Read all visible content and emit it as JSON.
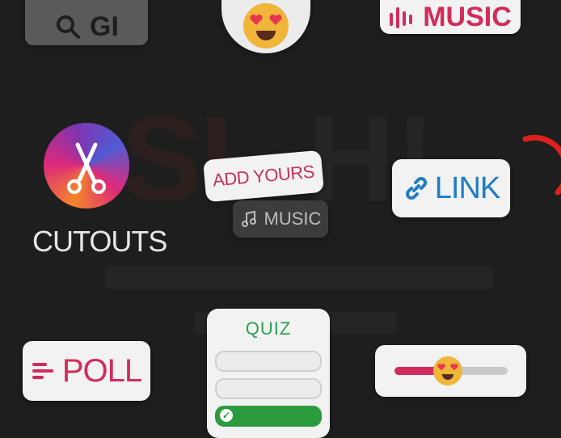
{
  "stickers": {
    "gif_search": {
      "label": "GI",
      "icon": "search-icon"
    },
    "emoji_reaction": {
      "icon": "heart-eyes-emoji-icon"
    },
    "music_top": {
      "label": "MUSIC",
      "icon": "music-bars-icon",
      "accent": "#d32b5b"
    },
    "cutouts": {
      "label": "CUTOUTS",
      "icon": "scissors-icon"
    },
    "add_yours": {
      "label": "ADD YOURS",
      "accent": "#c2325f"
    },
    "music_dark": {
      "label": "MUSIC",
      "icon": "music-note-icon"
    },
    "link": {
      "label": "LINK",
      "icon": "link-icon",
      "accent": "#1f7dc4"
    },
    "poll": {
      "label": "POLL",
      "icon": "poll-lines-icon",
      "accent": "#d32b5b"
    },
    "quiz": {
      "label": "QUIZ",
      "accent": "#2e9f53",
      "options": [
        "",
        "",
        ""
      ]
    },
    "emoji_slider": {
      "icon": "heart-eyes-emoji-icon",
      "level": 0.42
    }
  },
  "background": {
    "art_text": [
      "SI",
      "H!"
    ]
  }
}
